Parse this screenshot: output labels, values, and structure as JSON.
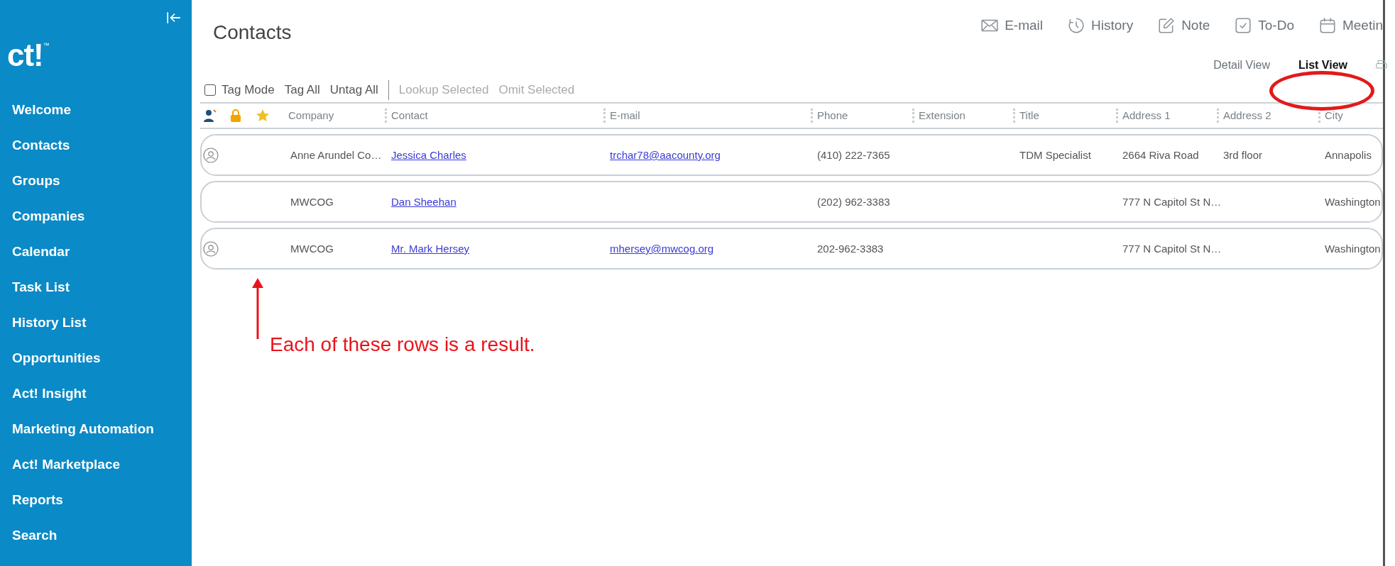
{
  "sidebar": {
    "logo": "ct!$^{™}$",
    "items": [
      {
        "label": "Welcome"
      },
      {
        "label": "Contacts"
      },
      {
        "label": "Groups"
      },
      {
        "label": "Companies"
      },
      {
        "label": "Calendar"
      },
      {
        "label": "Task List"
      },
      {
        "label": "History List"
      },
      {
        "label": "Opportunities"
      },
      {
        "label": "Act! Insight"
      },
      {
        "label": "Marketing Automation"
      },
      {
        "label": "Act! Marketplace"
      },
      {
        "label": "Reports"
      },
      {
        "label": "Search"
      }
    ]
  },
  "page_title": "Contacts",
  "actions": [
    {
      "kind": "email",
      "label": "E-mail"
    },
    {
      "kind": "history",
      "label": "History"
    },
    {
      "kind": "note",
      "label": "Note"
    },
    {
      "kind": "todo",
      "label": "To-Do"
    },
    {
      "kind": "meeting",
      "label": "Meetin"
    }
  ],
  "views": [
    {
      "label": "Detail View",
      "selected": false
    },
    {
      "label": "List View",
      "selected": true
    }
  ],
  "tag_bar": {
    "tag_mode": {
      "label": "Tag Mode",
      "checked": false
    },
    "commands": [
      {
        "label": "Tag All",
        "disabled": false
      },
      {
        "label": "Untag All",
        "disabled": false
      },
      {
        "label": "Lookup Selected",
        "disabled": true
      },
      {
        "label": "Omit Selected",
        "disabled": true
      }
    ]
  },
  "table": {
    "columns": [
      "Company",
      "Contact",
      "E-mail",
      "Phone",
      "Extension",
      "Title",
      "Address 1",
      "Address 2",
      "City"
    ],
    "rows": [
      {
        "avatar": true,
        "cells": [
          "Anne Arundel Co…",
          "Jessica Charles",
          "trchar78@aacounty.org",
          "(410) 222-7365",
          "",
          "TDM Specialist",
          "2664 Riva Road",
          "3rd floor",
          "Annapolis"
        ]
      },
      {
        "avatar": false,
        "cells": [
          "MWCOG",
          "Dan Sheehan",
          "",
          "(202) 962-3383",
          "",
          "",
          "777 N Capitol St N…",
          "",
          "Washington"
        ]
      },
      {
        "avatar": true,
        "cells": [
          "MWCOG",
          "Mr. Mark Hersey",
          "mhersey@mwcog.org",
          "202-962-3383",
          "",
          "",
          "777 N Capitol St N…",
          "",
          "Washington"
        ]
      }
    ]
  },
  "annotation": "Each of these rows is a result."
}
